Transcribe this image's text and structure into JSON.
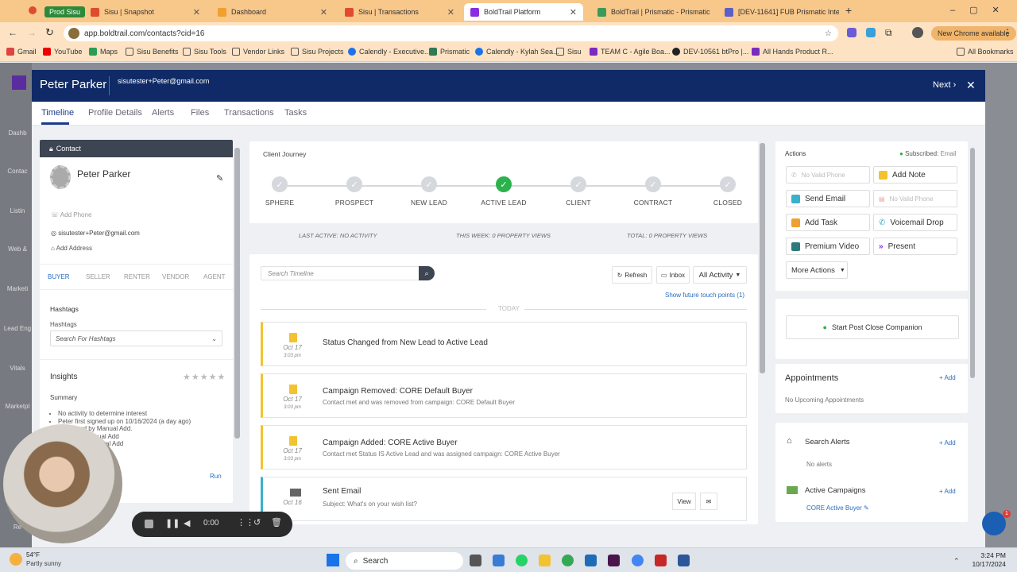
{
  "browser": {
    "tabs": [
      {
        "label": "Prod Sisu",
        "color": "#2d8a3a"
      },
      {
        "label": "Sisu | Snapshot",
        "color": "#e04a2f"
      },
      {
        "label": "Dashboard",
        "color": "#f0a030"
      },
      {
        "label": "Sisu | Transactions",
        "color": "#e04a2f"
      },
      {
        "label": "BoldTrail Platform",
        "color": "#8a2be2"
      },
      {
        "label": "BoldTrail | Prismatic - Prismatic",
        "color": "#3a9a5a"
      },
      {
        "label": "[DEV-11641] FUB Prismatic Inte...",
        "color": "#5b5fc7"
      }
    ],
    "url": "app.boldtrail.com/contacts?cid=16",
    "chrome_available": "New Chrome available",
    "bookmarks": [
      "Gmail",
      "YouTube",
      "Maps",
      "Sisu Benefits",
      "Sisu Tools",
      "Vendor Links",
      "Sisu Projects",
      "Calendly - Executive...",
      "Prismatic",
      "Calendly - Kylah Sea...",
      "Sisu",
      "TEAM C - Agile Boa...",
      "DEV-10561 btPro |...",
      "All Hands Product R..."
    ],
    "all_bookmarks": "All Bookmarks"
  },
  "rail": [
    "Dashb",
    "Contac",
    "Listin",
    "Web &",
    "Marketi",
    "Lead Eng",
    "Vitals",
    "Marketpl",
    "Re"
  ],
  "header": {
    "name": "Peter Parker",
    "email": "sisutester+Peter@gmail.com",
    "next": "Next ›",
    "close": "✕"
  },
  "nav_tabs": [
    "Timeline",
    "Profile Details",
    "Alerts",
    "Files",
    "Transactions",
    "Tasks"
  ],
  "contact": {
    "section_label": "Contact",
    "name": "Peter Parker",
    "add_phone": "Add Phone",
    "email": "sisutester+Peter@gmail.com",
    "add_address": "Add Address",
    "roles": [
      "BUYER",
      "SELLER",
      "RENTER",
      "VENDOR",
      "AGENT"
    ],
    "hashtags_title": "Hashtags",
    "hashtags_label": "Hashtags",
    "hashtags_placeholder": "Search For Hashtags",
    "insights": "Insights",
    "summary": "Summary",
    "summary_items": [
      "No activity to determine interest",
      "Peter first signed up on 10/16/2024 (a day ago)",
      "generated by Manual Add.",
      "ual Add",
      "Manual Add"
    ],
    "run": "Run"
  },
  "journey": {
    "title": "Client Journey",
    "steps": [
      {
        "label": "SPHERE",
        "done": false
      },
      {
        "label": "PROSPECT",
        "done": false
      },
      {
        "label": "NEW LEAD",
        "done": false
      },
      {
        "label": "ACTIVE LEAD",
        "done": true
      },
      {
        "label": "CLIENT",
        "done": false
      },
      {
        "label": "CONTRACT",
        "done": false
      },
      {
        "label": "CLOSED",
        "done": false
      }
    ],
    "last_active": "LAST ACTIVE: NO ACTIVITY",
    "this_week": "THIS WEEK: 0 PROPERTY VIEWS",
    "total": "TOTAL: 0 PROPERTY VIEWS"
  },
  "timeline": {
    "search_placeholder": "Search Timeline",
    "refresh": "Refresh",
    "inbox": "Inbox",
    "all_activity": "All Activity",
    "future": "Show future touch points (1)",
    "today": "TODAY",
    "items": [
      {
        "date": "Oct 17",
        "time": "3:03 pm",
        "title": "Status Changed from New Lead to Active Lead",
        "sub": ""
      },
      {
        "date": "Oct 17",
        "time": "3:03 pm",
        "title": "Campaign Removed: CORE Default Buyer",
        "sub": "Contact met and was removed from campaign: CORE Default Buyer"
      },
      {
        "date": "Oct 17",
        "time": "3:03 pm",
        "title": "Campaign Added: CORE Active Buyer",
        "sub": "Contact met Status IS Active Lead and was assigned campaign: CORE Active Buyer"
      },
      {
        "date": "Oct 16",
        "time": "",
        "title": "Sent Email",
        "sub": "Subject: What's on your wish list?"
      }
    ],
    "view": "View"
  },
  "actions": {
    "title": "Actions",
    "subscribed_label": "Subscribed:",
    "subscribed_value": "Email",
    "buttons": {
      "no_valid_phone": "No Valid Phone",
      "add_note": "Add Note",
      "send_email": "Send Email",
      "no_valid_phone2": "No Valid Phone",
      "add_task": "Add Task",
      "voicemail_drop": "Voicemail Drop",
      "premium_video": "Premium Video",
      "present": "Present",
      "more_actions": "More Actions"
    },
    "start_post_close": "Start Post Close Companion"
  },
  "appointments": {
    "title": "Appointments",
    "add": "+ Add",
    "empty": "No Upcoming Appointments"
  },
  "search_alerts": {
    "title": "Search Alerts",
    "add": "+ Add",
    "empty": "No alerts"
  },
  "active_campaigns": {
    "title": "Active Campaigns",
    "add": "+ Add",
    "item": "CORE Active Buyer"
  },
  "recorder": {
    "time": "0:00"
  },
  "taskbar": {
    "weather_temp": "54°F",
    "weather_desc": "Partly sunny",
    "search": "Search",
    "time": "3:24 PM",
    "date": "10/17/2024"
  },
  "colors": {
    "header": "#0f2a66",
    "accent": "#2a6dbd",
    "green": "#2bb24c",
    "yellow": "#f2c230",
    "teal": "#3bb0c9"
  }
}
